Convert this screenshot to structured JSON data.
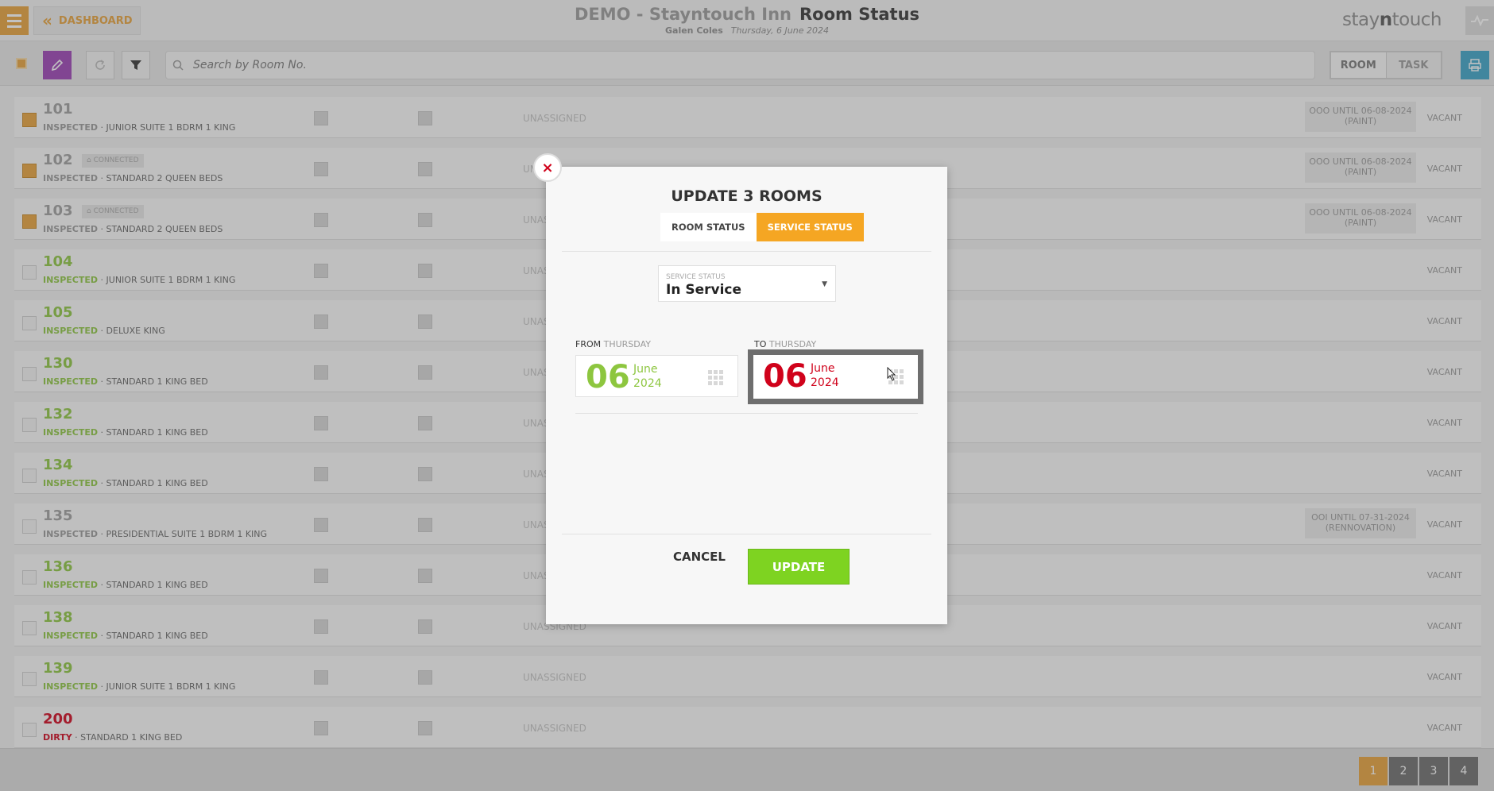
{
  "header": {
    "dashboard_label": "DASHBOARD",
    "hotel_name": "DEMO - Stayntouch Inn",
    "page_title": "Room Status",
    "user": "Galen Coles",
    "date": "Thursday, 6 June 2024",
    "logo_pre": "stay",
    "logo_n": "n",
    "logo_post": "touch"
  },
  "toolbar": {
    "search_placeholder": "Search by Room No.",
    "view_room": "ROOM",
    "view_task": "TASK"
  },
  "rooms": [
    {
      "number": "101",
      "status": "INSPECTED",
      "type": "JUNIOR SUITE 1 BDRM 1 KING",
      "assigned": "UNASSIGNED",
      "ooo_line1": "OOO UNTIL 06-08-2024",
      "ooo_line2": "(PAINT)",
      "occupancy": "VACANT"
    },
    {
      "number": "102",
      "status": "INSPECTED",
      "type": "STANDARD 2 QUEEN BEDS",
      "connected": "CONNECTED",
      "assigned": "UN",
      "ooo_line1": "OOO UNTIL 06-08-2024",
      "ooo_line2": "(PAINT)",
      "occupancy": "VACANT"
    },
    {
      "number": "103",
      "status": "INSPECTED",
      "type": "STANDARD 2 QUEEN BEDS",
      "connected": "CONNECTED",
      "assigned": "UNAS",
      "ooo_line1": "OOO UNTIL 06-08-2024",
      "ooo_line2": "(PAINT)",
      "occupancy": "VACANT"
    },
    {
      "number": "104",
      "status": "INSPECTED",
      "type": "JUNIOR SUITE 1 BDRM 1 KING",
      "assigned": "UNAS",
      "occupancy": "VACANT"
    },
    {
      "number": "105",
      "status": "INSPECTED",
      "type": "DELUXE KING",
      "assigned": "UNAS",
      "occupancy": "VACANT"
    },
    {
      "number": "130",
      "status": "INSPECTED",
      "type": "STANDARD 1 KING BED",
      "assigned": "UNAS",
      "occupancy": "VACANT"
    },
    {
      "number": "132",
      "status": "INSPECTED",
      "type": "STANDARD 1 KING BED",
      "assigned": "UNAS",
      "occupancy": "VACANT"
    },
    {
      "number": "134",
      "status": "INSPECTED",
      "type": "STANDARD 1 KING BED",
      "assigned": "UNAS",
      "occupancy": "VACANT"
    },
    {
      "number": "135",
      "status": "INSPECTED",
      "type": "PRESIDENTIAL SUITE 1 BDRM 1 KING",
      "assigned": "UNAS",
      "ooo_line1": "OOI UNTIL 07-31-2024",
      "ooo_line2": "(RENNOVATION)",
      "occupancy": "VACANT"
    },
    {
      "number": "136",
      "status": "INSPECTED",
      "type": "STANDARD 1 KING BED",
      "assigned": "UNAS",
      "occupancy": "VACANT"
    },
    {
      "number": "138",
      "status": "INSPECTED",
      "type": "STANDARD 1 KING BED",
      "assigned": "UNASSIGNED",
      "occupancy": "VACANT"
    },
    {
      "number": "139",
      "status": "INSPECTED",
      "type": "JUNIOR SUITE 1 BDRM 1 KING",
      "assigned": "UNASSIGNED",
      "occupancy": "VACANT"
    },
    {
      "number": "200",
      "status": "DIRTY",
      "type": "STANDARD 1 KING BED",
      "assigned": "UNASSIGNED",
      "occupancy": "VACANT"
    }
  ],
  "pagination": [
    "1",
    "2",
    "3",
    "4"
  ],
  "modal": {
    "close_symbol": "×",
    "title": "UPDATE 3 ROOMS",
    "tab_room_status": "ROOM STATUS",
    "tab_service_status": "SERVICE STATUS",
    "service_status_label": "SERVICE STATUS",
    "service_status_value": "In Service",
    "from_label": "FROM",
    "from_day": "THURSDAY",
    "from_dd": "06",
    "from_month": "June",
    "from_year": "2024",
    "to_label": "TO",
    "to_day": "THURSDAY",
    "to_dd": "06",
    "to_month": "June",
    "to_year": "2024",
    "cancel_label": "CANCEL",
    "update_label": "UPDATE"
  },
  "colors": {
    "accent": "#e8a23a",
    "green": "#8dc63f",
    "red": "#d0021b",
    "update_button": "#7ed321"
  }
}
